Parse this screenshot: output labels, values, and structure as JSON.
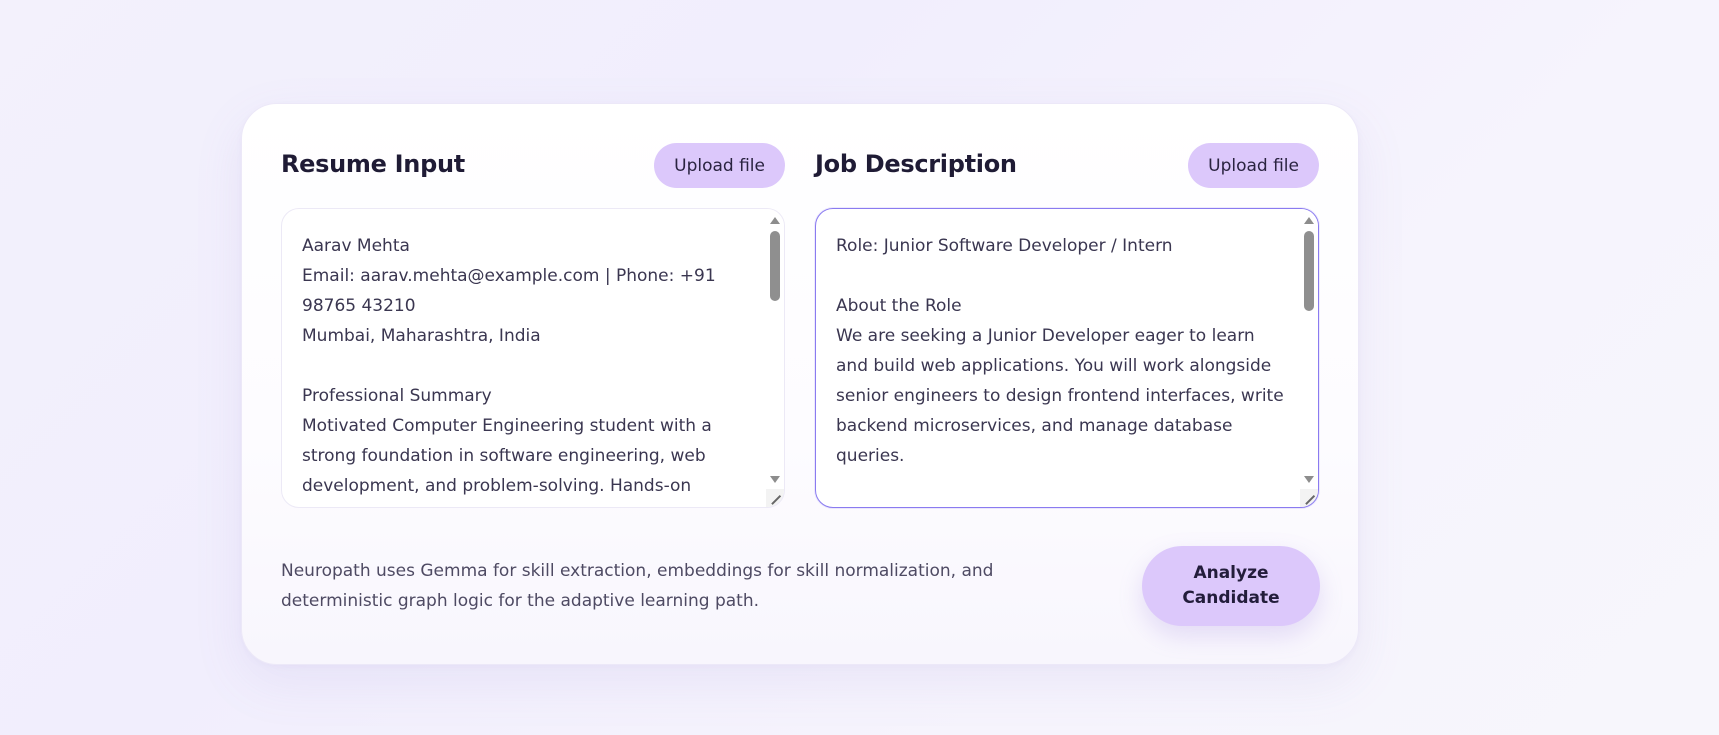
{
  "resume": {
    "title": "Resume Input",
    "upload_label": "Upload file",
    "text": "Aarav Mehta\nEmail: aarav.mehta@example.com | Phone: +91 98765 43210\nMumbai, Maharashtra, India\n\nProfessional Summary\nMotivated Computer Engineering student with a strong foundation in software engineering, web development, and problem-solving. Hands-on"
  },
  "job": {
    "title": "Job Description",
    "upload_label": "Upload file",
    "text": "Role: Junior Software Developer / Intern\n\nAbout the Role\nWe are seeking a Junior Developer eager to learn and build web applications. You will work alongside senior engineers to design frontend interfaces, write backend microservices, and manage database queries."
  },
  "footer": {
    "note": "Neuropath uses Gemma for skill extraction, embeddings for skill normalization, and deterministic graph logic for the adaptive learning path.",
    "analyze_label": "Analyze Candidate"
  },
  "colors": {
    "accent_button": "#dcc8fb",
    "focus_border": "#8a7bf0"
  },
  "icons": {
    "scroll_up": "triangle-up",
    "scroll_down": "triangle-down",
    "resize": "diagonal-grip"
  }
}
